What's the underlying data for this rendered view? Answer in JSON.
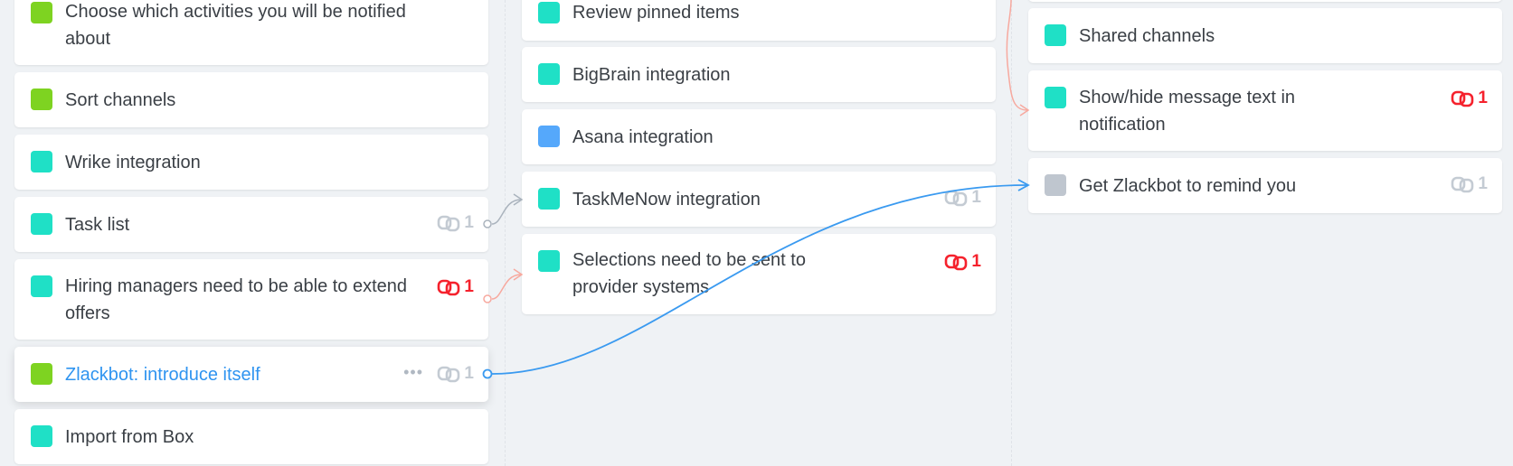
{
  "colors": {
    "green": "#7ed321",
    "teal": "#1fe0c6",
    "blue": "#55a8fb",
    "gray": "#bfc6cf",
    "link_blue": "#2f94f0",
    "red": "#f5222d"
  },
  "columns": [
    {
      "cards": [
        {
          "title": "Choose which activities you will be notified about",
          "swatch": "green"
        },
        {
          "title": "Sort channels",
          "swatch": "green"
        },
        {
          "title": "Wrike integration",
          "swatch": "teal"
        },
        {
          "title": "Task list",
          "swatch": "teal",
          "badge": {
            "count": "1",
            "color": "gray",
            "icon": "link-icon"
          }
        },
        {
          "title": "Hiring managers need to be able to extend offers",
          "swatch": "teal",
          "badge": {
            "count": "1",
            "color": "red",
            "icon": "link-icon"
          }
        },
        {
          "title": "Zlackbot: introduce itself",
          "swatch": "green",
          "highlighted": true,
          "more_icon": "more-dots-icon",
          "badge": {
            "count": "1",
            "color": "gray",
            "icon": "link-icon"
          }
        },
        {
          "title": "Import from Box",
          "swatch": "teal"
        }
      ]
    },
    {
      "cards": [
        {
          "title": "Review pinned items",
          "swatch": "teal"
        },
        {
          "title": "BigBrain integration",
          "swatch": "teal"
        },
        {
          "title": "Asana integration",
          "swatch": "blue"
        },
        {
          "title": "TaskMeNow integration",
          "swatch": "teal",
          "badge": {
            "count": "1",
            "color": "gray",
            "icon": "link-icon"
          }
        },
        {
          "title": "Selections need to be sent to provider systems",
          "swatch": "teal",
          "badge": {
            "count": "1",
            "color": "red",
            "icon": "link-icon"
          }
        }
      ]
    },
    {
      "cards": [
        {
          "title": "Shared channels",
          "swatch": "teal"
        },
        {
          "title": "Show/hide message text in notification",
          "swatch": "teal",
          "badge": {
            "count": "1",
            "color": "red",
            "icon": "link-icon"
          }
        },
        {
          "title": "Get Zlackbot to remind you",
          "swatch": "gray",
          "badge": {
            "count": "1",
            "color": "gray",
            "icon": "link-icon"
          }
        }
      ]
    }
  ]
}
